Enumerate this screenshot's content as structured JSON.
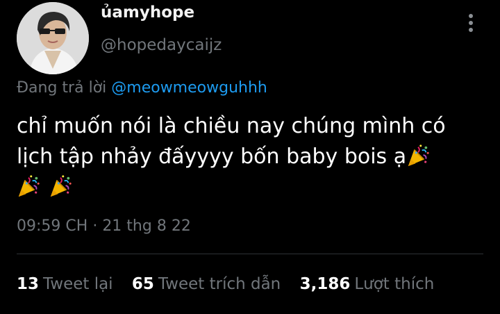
{
  "author": {
    "display_name": "ủamyhope",
    "handle": "@hopedaycaijz"
  },
  "reply": {
    "prefix": "Đang trả lời",
    "mention": "@meowmeowguhhh"
  },
  "tweet": {
    "line1": "chỉ muốn nói là chiều nay chúng mình có",
    "line2": "lịch tập nhảy đấyyyy bốn baby bois ạ",
    "emoji_icons": [
      "party-popper-icon",
      "party-popper-icon",
      "party-popper-icon"
    ]
  },
  "meta": {
    "time": "09:59 CH",
    "separator": "·",
    "date": "21 thg 8 22"
  },
  "stats": {
    "retweets": "13",
    "retweets_label": "Tweet lại",
    "quotes": "65",
    "quotes_label": "Tweet trích dẫn",
    "likes": "3,186",
    "likes_label": "Lượt thích"
  },
  "colors": {
    "background": "#000000",
    "mention": "#1d9bf0",
    "secondary_text": "#71767b",
    "divider": "#2f3336"
  }
}
